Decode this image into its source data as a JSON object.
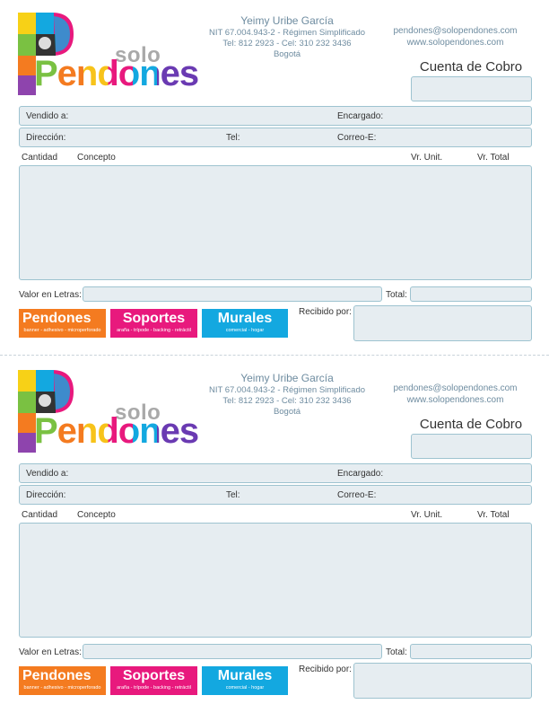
{
  "logo": {
    "solo": "solo",
    "pendones": "Pendones"
  },
  "issuer": {
    "name": "Yeimy Uribe García",
    "nit": "NIT 67.004.943-2 - Régimen Simplificado",
    "phones": "Tel: 812 2923 - Cel: 310 232 3436",
    "city": "Bogotá"
  },
  "contact": {
    "email": "pendones@solopendones.com",
    "web": "www.solopendones.com"
  },
  "document": {
    "title": "Cuenta de Cobro"
  },
  "client_fields": {
    "vendido": "Vendido a:",
    "encargado": "Encargado:",
    "direccion": "Dirección:",
    "tel": "Tel:",
    "correo": "Correo-E:"
  },
  "columns": {
    "cantidad": "Cantidad",
    "concepto": "Concepto",
    "unit": "Vr. Unit.",
    "total": "Vr. Total"
  },
  "footer": {
    "valor_letras": "Valor en Letras:",
    "total": "Total:",
    "recibido": "Recibido por:"
  },
  "badges": [
    {
      "title": "Pendones",
      "subtitle": "banner - adhesivo - microperforado"
    },
    {
      "title": "Soportes",
      "subtitle": "araña - trípode - backing - retráctil"
    },
    {
      "title": "Murales",
      "subtitle": "comercial - hogar"
    }
  ],
  "colors": {
    "field_fill": "#e6edf1",
    "field_border": "#9ec3d0",
    "accent_text": "#6e8ca0",
    "orange": "#f47b20",
    "magenta": "#e8197d",
    "cyan": "#13a8e0"
  }
}
